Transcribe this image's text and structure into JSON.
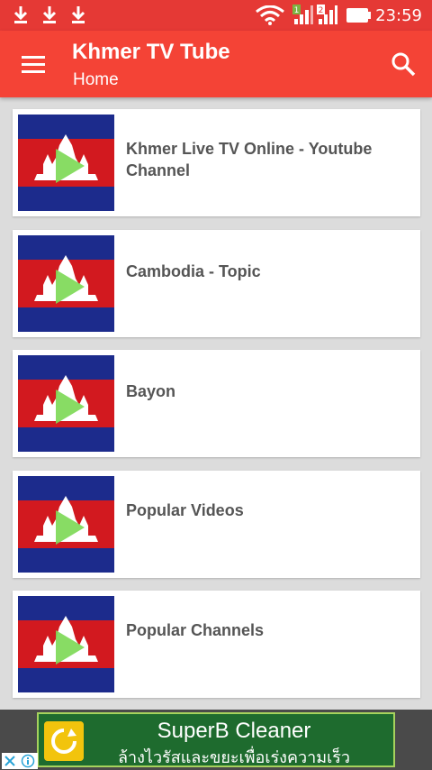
{
  "status_bar": {
    "time": "23:59",
    "icons": [
      "download-icon",
      "download-icon",
      "download-icon",
      "wifi-icon",
      "signal-sim1-icon",
      "signal-sim2-icon",
      "battery-icon"
    ]
  },
  "app_bar": {
    "title": "Khmer TV Tube",
    "subtitle": "Home",
    "menu_icon": "hamburger-menu-icon",
    "search_icon": "search-icon"
  },
  "items": [
    {
      "label": "Khmer Live TV Online - Youtube Channel",
      "thumbnail": "cambodia-flag-play-icon"
    },
    {
      "label": "Cambodia - Topic",
      "thumbnail": "cambodia-flag-play-icon"
    },
    {
      "label": "Bayon",
      "thumbnail": "cambodia-flag-play-icon"
    },
    {
      "label": "Popular Videos",
      "thumbnail": "cambodia-flag-play-icon"
    },
    {
      "label": "Popular Channels",
      "thumbnail": "cambodia-flag-play-icon"
    }
  ],
  "ad": {
    "title": "SuperB Cleaner",
    "subtitle": "ล้างไวรัสและขยะเพื่อเร่งความเร็ว",
    "icon": "superb-cleaner-app-icon",
    "controls": [
      "close-icon",
      "info-icon"
    ]
  },
  "colors": {
    "status_bar": "#e53935",
    "app_bar": "#f44336",
    "flag_blue": "#1c2b8c",
    "flag_red": "#d2191f",
    "play": "#7ed957",
    "ad_background": "#1e6b2e"
  }
}
